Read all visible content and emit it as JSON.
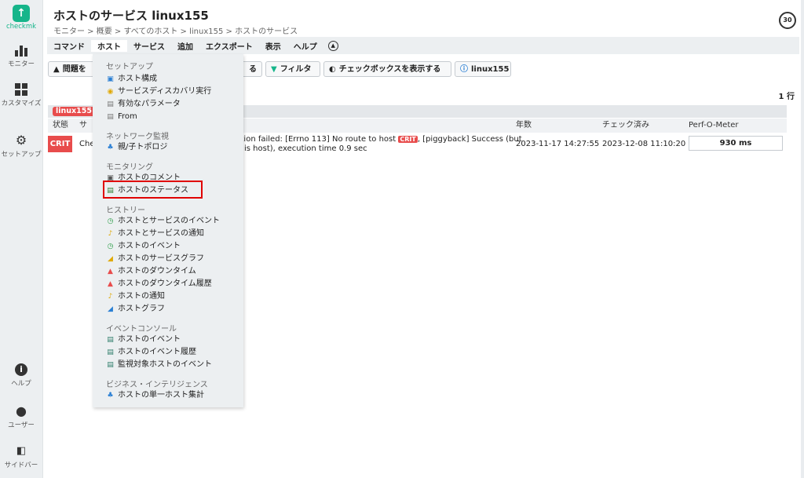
{
  "sidebar": {
    "logo_text": "checkmk",
    "items": [
      {
        "label": "モニター"
      },
      {
        "label": "カスタマイズ"
      },
      {
        "label": "セットアップ"
      },
      {
        "label": "ヘルプ"
      },
      {
        "label": "ユーザー"
      },
      {
        "label": "サイドバー"
      }
    ]
  },
  "header": {
    "title": "ホストのサービス linux155",
    "breadcrumb": "モニター > 概要 > すべてのホスト > linux155 > ホストのサービス",
    "refresh_seconds": "30"
  },
  "menubar": {
    "items": [
      "コマンド",
      "ホスト",
      "サービス",
      "追加",
      "エクスポート",
      "表示",
      "ヘルプ"
    ]
  },
  "toolbar": {
    "problem_btn": "問題を",
    "partial_btn": "る",
    "filter_btn": "フィルタ",
    "checkbox_btn": "チェックボックスを表示する",
    "host_btn": "linux155"
  },
  "table": {
    "row_count": "1 行",
    "host_tag": "linux155",
    "headers": {
      "state": "状態",
      "service": "サ",
      "age": "年数",
      "checked": "チェック済み",
      "perf": "Perf-O-Meter"
    },
    "row": {
      "state": "CRIT",
      "service": "Che",
      "summary_line1_a": "ction failed: [Errno 113] No route to host",
      "summary_badge": "CRIT",
      "summary_line1_b": ", [piggyback] Success (but",
      "summary_line2": "is host), execution time 0.9 sec",
      "age": "2023-11-17 14:27:55",
      "checked": "2023-12-08 11:10:20",
      "perf": "930 ms"
    }
  },
  "dropdown": {
    "sections": {
      "setup": "セットアップ",
      "network": "ネットワーク監視",
      "monitoring": "モニタリング",
      "history": "ヒストリー",
      "event_console": "イベントコンソール",
      "bi": "ビジネス・インテリジェンス"
    },
    "items": {
      "host_config": "ホスト構成",
      "service_discovery": "サービスディスカバリ実行",
      "effective_params": "有効なパラメータ",
      "from": "From",
      "topology": "親/子トポロジ",
      "host_comments": "ホストのコメント",
      "host_status": "ホストのステータス",
      "host_service_events": "ホストとサービスのイベント",
      "host_service_notifications": "ホストとサービスの通知",
      "host_events": "ホストのイベント",
      "host_service_graphs": "ホストのサービスグラフ",
      "host_downtimes": "ホストのダウンタイム",
      "host_downtime_history": "ホストのダウンタイム履歴",
      "host_notifications": "ホストの通知",
      "host_graphs": "ホストグラフ",
      "ec_host_events": "ホストのイベント",
      "ec_host_event_history": "ホストのイベント履歴",
      "ec_monitored_host_events": "監視対象ホストのイベント",
      "bi_single_host": "ホストの単一ホスト集計"
    }
  }
}
